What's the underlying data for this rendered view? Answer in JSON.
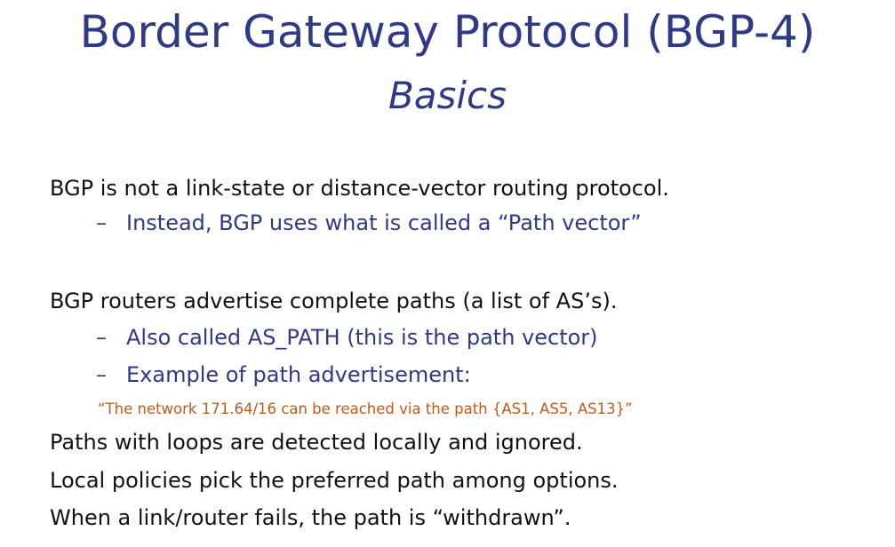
{
  "slide": {
    "title": "Border Gateway Protocol (BGP-4)",
    "subtitle": "Basics"
  },
  "bullets": {
    "b1": "BGP is not a link-state or distance-vector routing protocol.",
    "b1_sub1": "Instead, BGP uses what is called a “Path vector”",
    "b2": "BGP routers advertise complete paths (a list of AS’s).",
    "b2_sub1": "Also called AS_PATH (this is the path vector)",
    "b2_sub2": "Example of path advertisement:",
    "b2_quote": "“The network 171.64/16 can be reached via the path {AS1, AS5, AS13}”",
    "b3": "Paths with loops are detected locally and ignored.",
    "b4": "Local policies pick the preferred path among options.",
    "b5": "When a link/router fails, the path is “withdrawn”.",
    "dash": "–"
  },
  "colors": {
    "title": "#2e3a87",
    "body_text": "#111111",
    "sub_bullet": "#2e3a87",
    "quote": "#c25a1c",
    "background": "#ffffff"
  }
}
